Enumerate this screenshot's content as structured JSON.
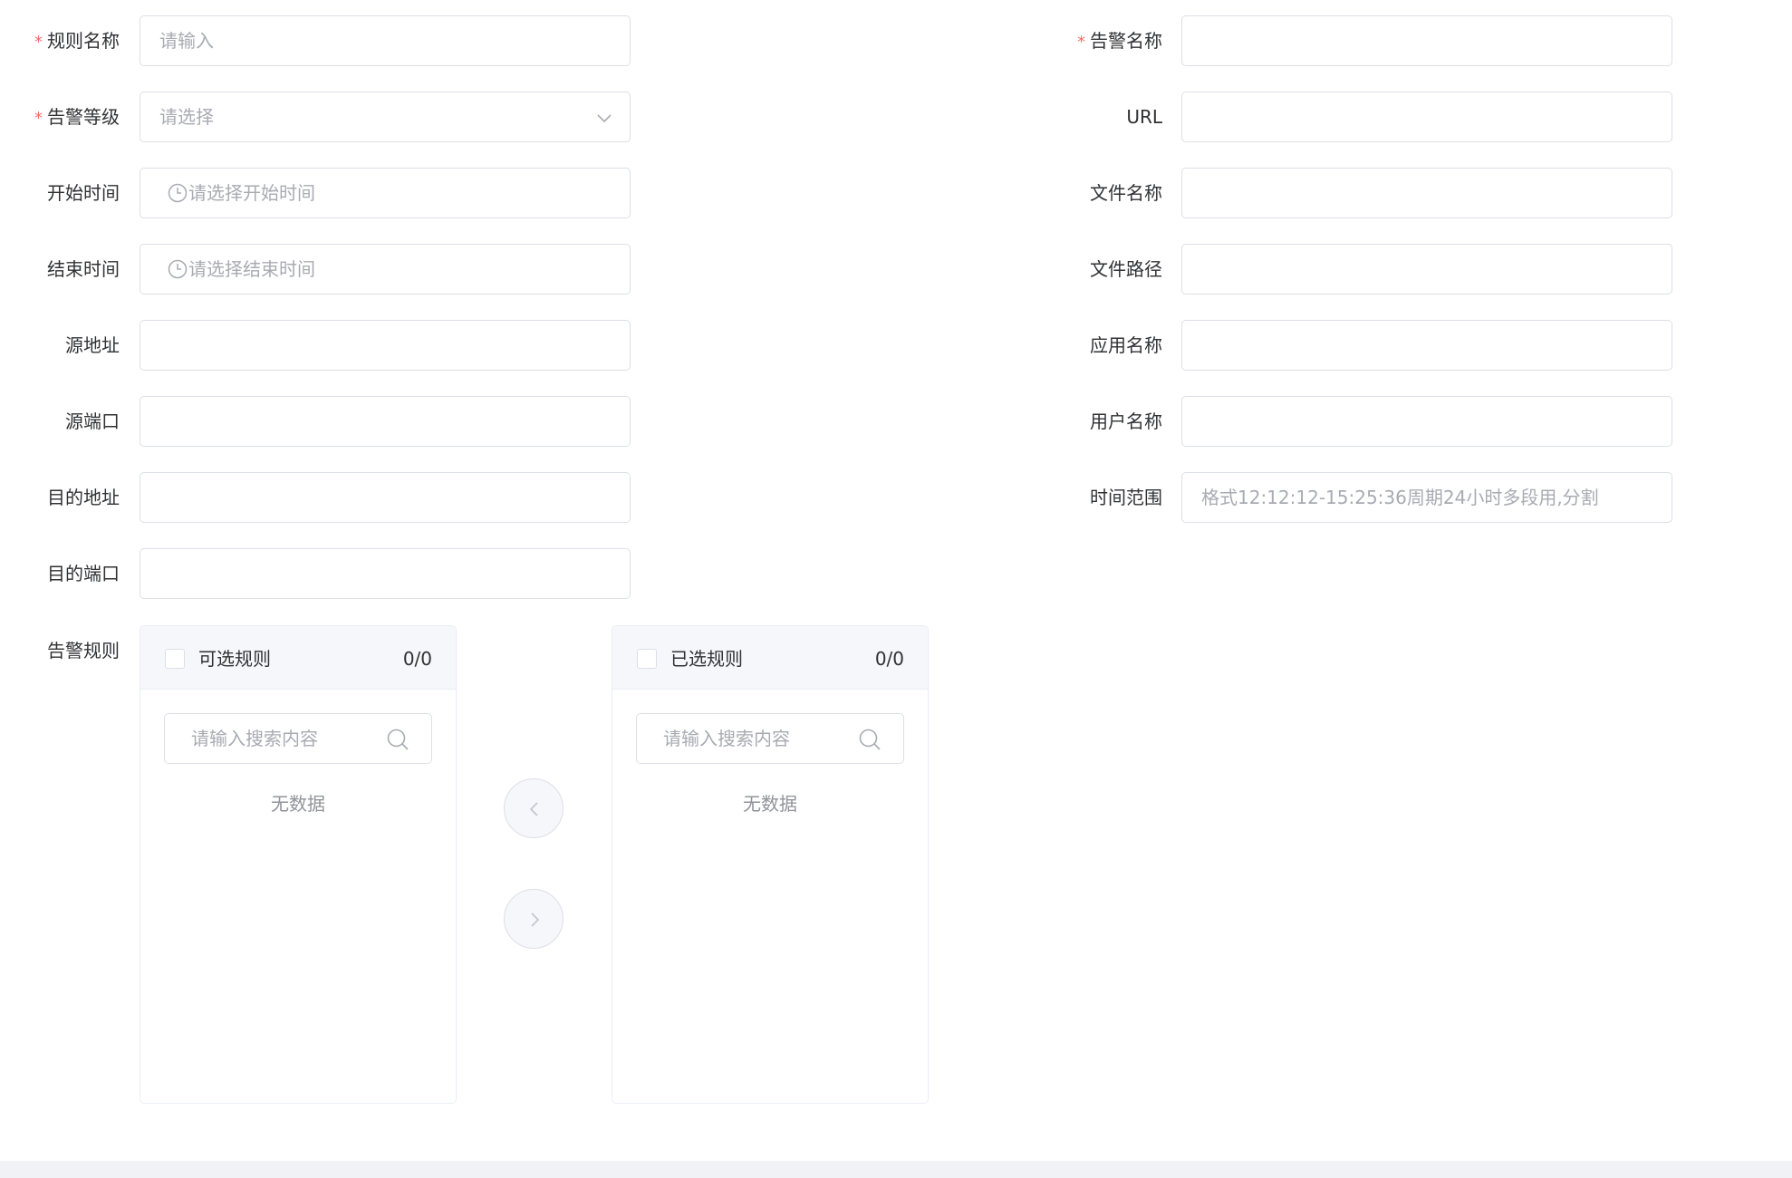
{
  "left_fields": [
    {
      "label": "规则名称",
      "required": true,
      "placeholder": "请输入",
      "type": "text"
    },
    {
      "label": "告警等级",
      "required": true,
      "placeholder": "请选择",
      "type": "select"
    },
    {
      "label": "开始时间",
      "required": false,
      "placeholder": "请选择开始时间",
      "type": "time"
    },
    {
      "label": "结束时间",
      "required": false,
      "placeholder": "请选择结束时间",
      "type": "time"
    },
    {
      "label": "源地址",
      "required": false,
      "placeholder": "",
      "type": "text"
    },
    {
      "label": "源端口",
      "required": false,
      "placeholder": "",
      "type": "text"
    },
    {
      "label": "目的地址",
      "required": false,
      "placeholder": "",
      "type": "text"
    },
    {
      "label": "目的端口",
      "required": false,
      "placeholder": "",
      "type": "text"
    }
  ],
  "right_fields": [
    {
      "label": "告警名称",
      "required": true,
      "placeholder": ""
    },
    {
      "label": "URL",
      "required": false,
      "placeholder": ""
    },
    {
      "label": "文件名称",
      "required": false,
      "placeholder": ""
    },
    {
      "label": "文件路径",
      "required": false,
      "placeholder": ""
    },
    {
      "label": "应用名称",
      "required": false,
      "placeholder": ""
    },
    {
      "label": "用户名称",
      "required": false,
      "placeholder": ""
    },
    {
      "label": "时间范围",
      "required": false,
      "placeholder": "格式12:12:12-15:25:36周期24小时多段用,分割"
    }
  ],
  "required_mark": "*",
  "transfer": {
    "label": "告警规则",
    "left": {
      "title": "可选规则",
      "count": "0/0",
      "search_placeholder": "请输入搜索内容",
      "empty": "无数据"
    },
    "right": {
      "title": "已选规则",
      "count": "0/0",
      "search_placeholder": "请输入搜索内容",
      "empty": "无数据"
    }
  },
  "icons": {
    "clock": "clock-icon",
    "select": "chevron-down-icon",
    "search": "search-icon",
    "move_left": "chevron-left-icon",
    "move_right": "chevron-right-icon"
  },
  "colors": {
    "required": "#f56c6c",
    "border": "#dcdfe6",
    "placeholder": "#a8abb2",
    "panel_header": "#f5f7fa"
  }
}
